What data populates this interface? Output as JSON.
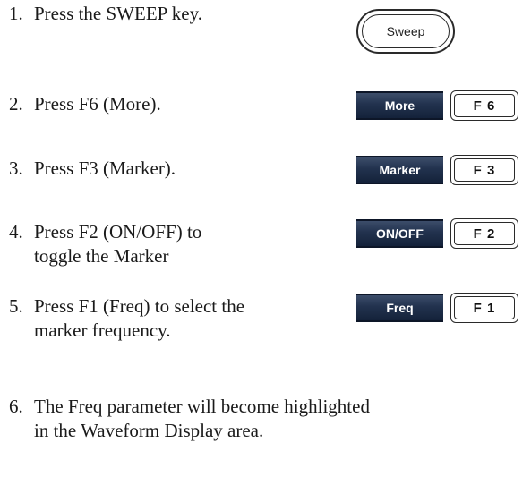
{
  "steps": [
    {
      "num": "1.",
      "lines": [
        "Press the SWEEP key."
      ]
    },
    {
      "num": "2.",
      "lines": [
        "Press F6 (More)."
      ]
    },
    {
      "num": "3.",
      "lines": [
        "Press F3 (Marker)."
      ]
    },
    {
      "num": "4.",
      "lines": [
        "Press F2 (ON/OFF) to",
        "toggle the Marker"
      ]
    },
    {
      "num": "5.",
      "lines": [
        "Press F1 (Freq) to select the",
        "marker frequency."
      ]
    },
    {
      "num": "6.",
      "lines": [
        "The Freq parameter will become highlighted",
        "in the Waveform Display area."
      ]
    }
  ],
  "keys": {
    "sweep": "Sweep",
    "softkeys": [
      "More",
      "Marker",
      "ON/OFF",
      "Freq"
    ],
    "fkeys": [
      "F 6",
      "F 3",
      "F 2",
      "F 1"
    ]
  },
  "colors": {
    "softkey_bg": "#22324e",
    "softkey_text": "#ffffff"
  }
}
